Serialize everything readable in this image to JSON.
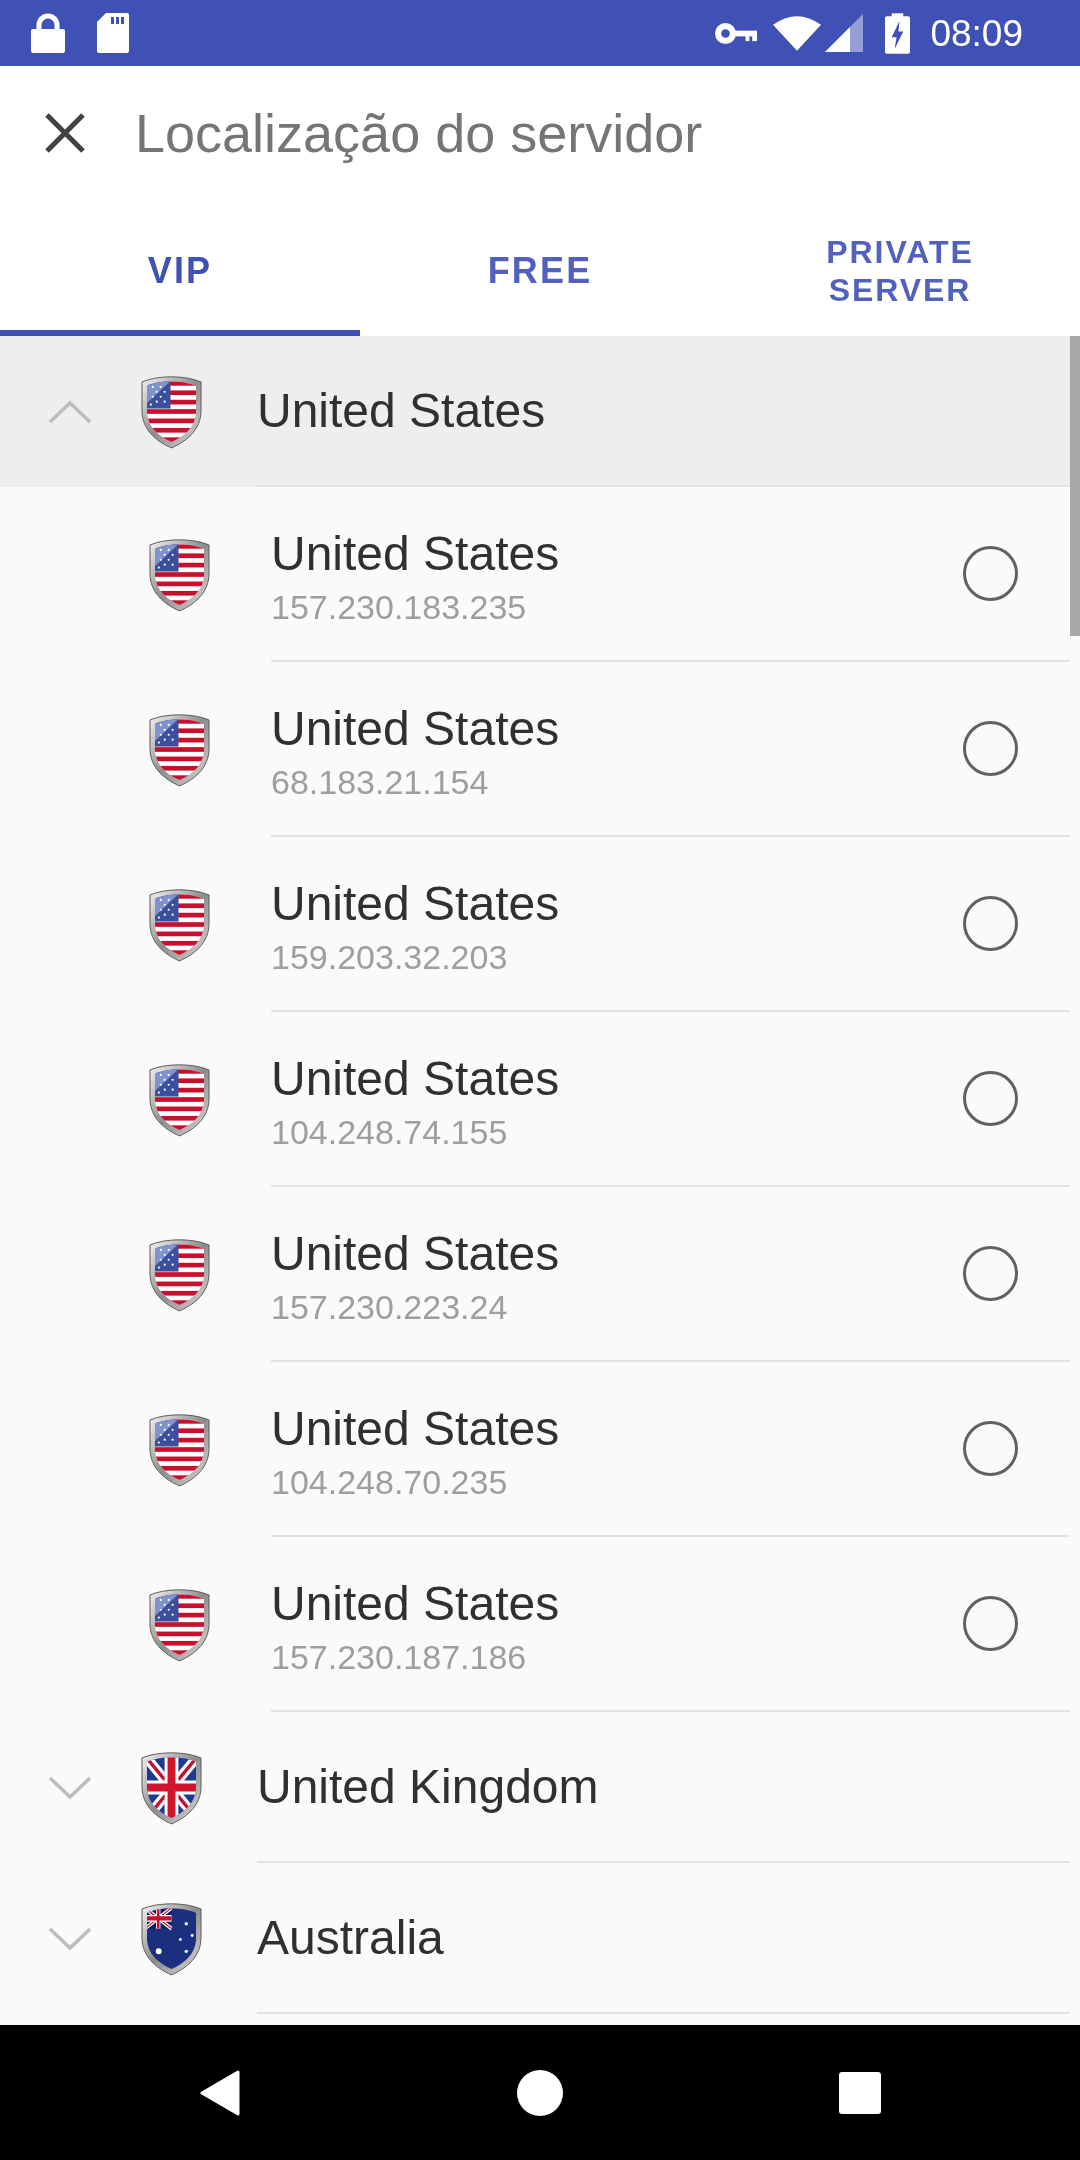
{
  "status_bar": {
    "time": "08:09"
  },
  "toolbar": {
    "title": "Localização do servidor"
  },
  "tabs": [
    {
      "label": "VIP",
      "selected": true
    },
    {
      "label": "FREE",
      "selected": false
    },
    {
      "label": "PRIVATE SERVER",
      "selected": false
    }
  ],
  "groups": [
    {
      "name": "United States",
      "expanded": true,
      "servers": [
        {
          "name": "United States",
          "ip": "157.230.183.235",
          "selected": false
        },
        {
          "name": "United States",
          "ip": "68.183.21.154",
          "selected": false
        },
        {
          "name": "United States",
          "ip": "159.203.32.203",
          "selected": false
        },
        {
          "name": "United States",
          "ip": "104.248.74.155",
          "selected": false
        },
        {
          "name": "United States",
          "ip": "157.230.223.24",
          "selected": false
        },
        {
          "name": "United States",
          "ip": "104.248.70.235",
          "selected": false
        },
        {
          "name": "United States",
          "ip": "157.230.187.186",
          "selected": false
        }
      ]
    },
    {
      "name": "United Kingdom",
      "expanded": false
    },
    {
      "name": "Australia",
      "expanded": false
    }
  ]
}
